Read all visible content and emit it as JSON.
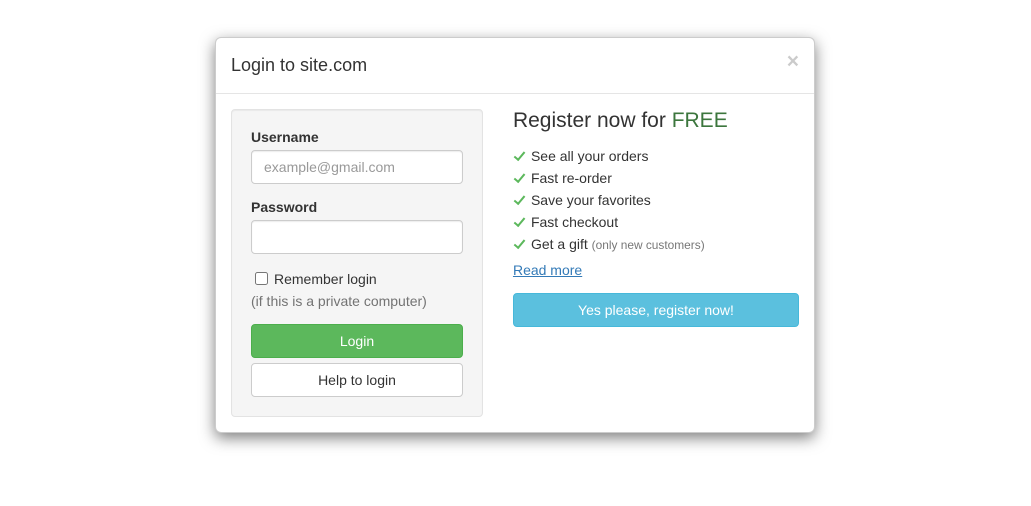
{
  "header": {
    "title": "Login to site.com"
  },
  "login": {
    "usernameLabel": "Username",
    "usernamePlaceholder": "example@gmail.com",
    "passwordLabel": "Password",
    "rememberLabel": "Remember login",
    "rememberHelp": "(if this is a private computer)",
    "loginButton": "Login",
    "helpButton": "Help to login"
  },
  "register": {
    "leadPrefix": "Register now for ",
    "leadHighlight": "FREE",
    "benefits": [
      {
        "text": "See all your orders"
      },
      {
        "text": "Fast re-order"
      },
      {
        "text": "Save your favorites"
      },
      {
        "text": "Fast checkout"
      },
      {
        "text": "Get a gift ",
        "small": "(only new customers)"
      }
    ],
    "readMore": "Read more",
    "registerButton": "Yes please, register now!"
  }
}
